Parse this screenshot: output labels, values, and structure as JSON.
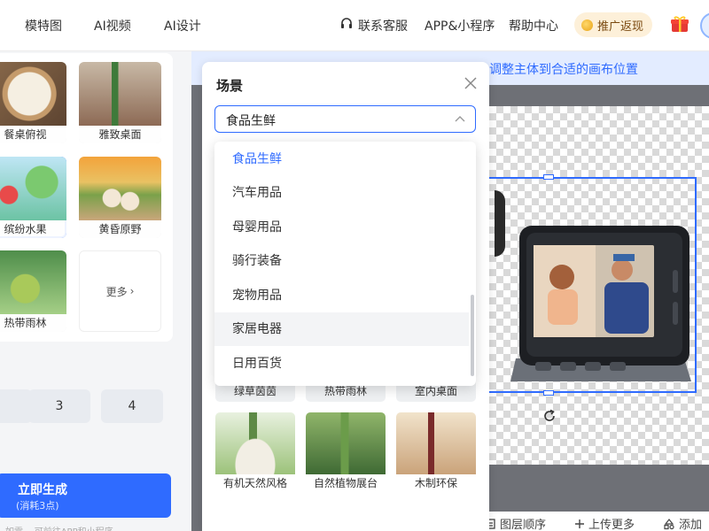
{
  "topnav": {
    "items": [
      "模特图",
      "AI视频",
      "AI设计",
      "联系客服",
      "APP&小程序",
      "帮助中心"
    ],
    "promo_label": "推广返现"
  },
  "left_panel": {
    "tiles": [
      {
        "label": "餐桌俯视",
        "selected": false
      },
      {
        "label": "雅致桌面",
        "selected": false
      },
      {
        "label": "缤纷水果",
        "selected": true
      },
      {
        "label": "黄昏原野",
        "selected": false
      },
      {
        "label": "热带雨林",
        "selected": false
      }
    ],
    "more_label": "更多",
    "counts": [
      "3",
      "4"
    ],
    "generate_title": "立即生成",
    "generate_sub": "(消耗3点)",
    "bottom_note": "如需... 可前往APP和小程序..."
  },
  "canvas": {
    "hint": "调整主体到合适的画布位置",
    "toolbar": [
      "图层顺序",
      "上传更多",
      "添加"
    ]
  },
  "scene_panel": {
    "title": "场景",
    "selected_value": "食品生鲜",
    "dropdown_options": [
      "食品生鲜",
      "汽车用品",
      "母婴用品",
      "骑行装备",
      "宠物用品",
      "家居电器",
      "日用百货"
    ],
    "active_option": "食品生鲜",
    "hover_option": "家居电器",
    "partial_tiles": [
      "绿草茵茵",
      "热带雨林",
      "室内桌面"
    ],
    "grid_tiles": [
      "有机天然风格",
      "自然植物展台",
      "木制环保"
    ]
  },
  "colors": {
    "accent": "#2f6bff",
    "hint_bg": "#e3ecff",
    "promo_bg": "#fdf0d9"
  }
}
